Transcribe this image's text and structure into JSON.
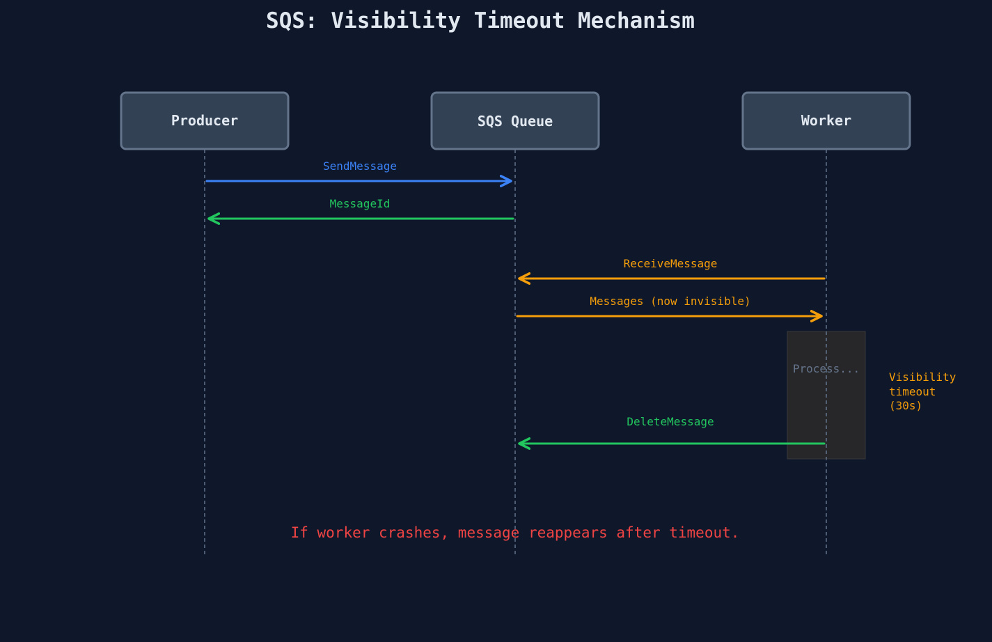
{
  "title": "SQS: Visibility Timeout Mechanism",
  "participants": [
    {
      "id": "producer",
      "label": "Producer"
    },
    {
      "id": "queue",
      "label": "SQS Queue"
    },
    {
      "id": "worker",
      "label": "Worker"
    }
  ],
  "messages": [
    {
      "id": "send",
      "label": "SendMessage",
      "from": "producer",
      "to": "queue",
      "color": "#3b82f6"
    },
    {
      "id": "msgid",
      "label": "MessageId",
      "from": "queue",
      "to": "producer",
      "color": "#22c55e"
    },
    {
      "id": "receive",
      "label": "ReceiveMessage",
      "from": "worker",
      "to": "queue",
      "color": "#f59e0b"
    },
    {
      "id": "messages",
      "label": "Messages (now invisible)",
      "from": "queue",
      "to": "worker",
      "color": "#f59e0b"
    },
    {
      "id": "delete",
      "label": "DeleteMessage",
      "from": "worker",
      "to": "queue",
      "color": "#22c55e"
    }
  ],
  "activation": {
    "label": "Process...",
    "participant": "worker"
  },
  "visibility_note": {
    "lines": [
      "Visibility",
      "timeout",
      "(30s)"
    ],
    "color": "#f59e0b"
  },
  "footer_note": {
    "text": "If worker crashes, message reappears after timeout.",
    "color": "#ef4444"
  },
  "colors": {
    "background": "#0f172a",
    "box_fill": "#334155",
    "box_stroke": "#64748b",
    "text_primary": "#e2e8f0",
    "lifeline": "#64748b",
    "activation_fill": "#27272a"
  }
}
